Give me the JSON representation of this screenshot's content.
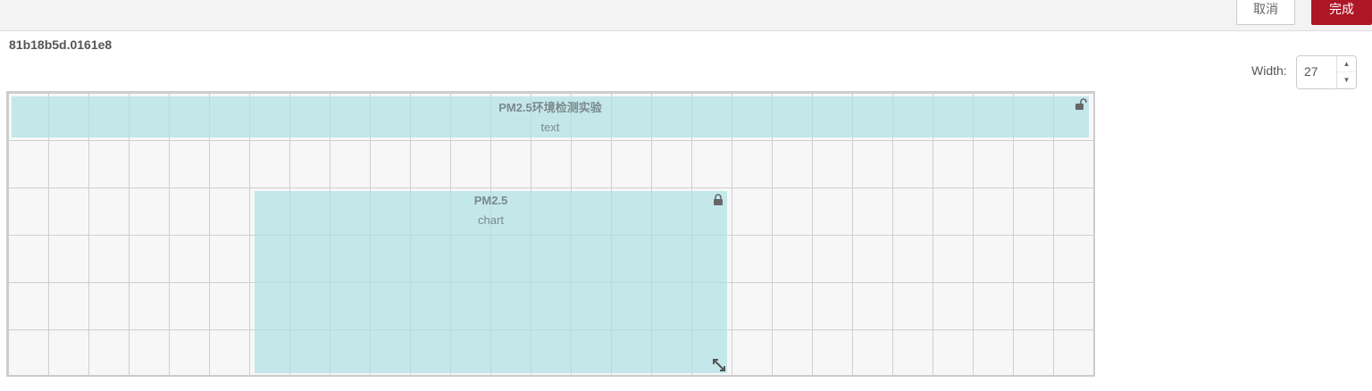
{
  "toolbar": {
    "cancel_label": "取消",
    "done_label": "完成",
    "done_color": "#ad1625"
  },
  "node": {
    "id": "81b18b5d.0161e8"
  },
  "width_control": {
    "label": "Width:",
    "value": "27"
  },
  "widgets": [
    {
      "title": "PM2.5环境检测实验",
      "type": "text",
      "lock": "unlock-icon"
    },
    {
      "title": "PM2.5",
      "type": "chart",
      "lock": "lock-icon",
      "resize": "resize-icon"
    }
  ],
  "colors": {
    "widget_fill": "#c4e6e9",
    "grid_bg": "#f7f7f7",
    "grid_line": "#cfcfcf"
  }
}
